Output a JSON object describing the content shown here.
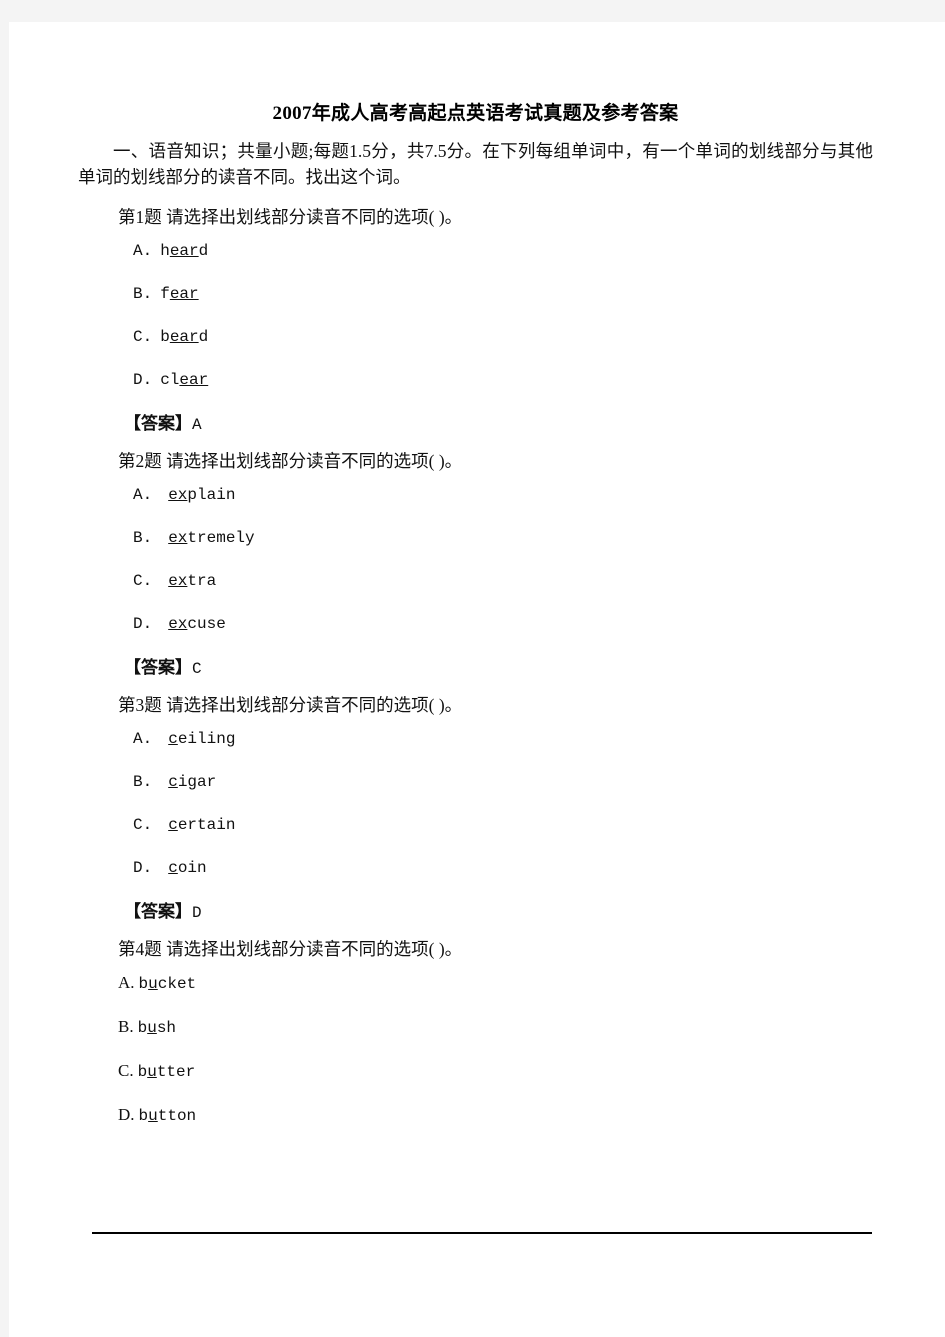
{
  "document": {
    "title": "2007年成人高考高起点英语考试真题及参考答案",
    "section_intro": "一、语音知识；共量小题;每题1.5分，共7.5分。在下列每组单词中，有一个单词的划线部分与其他单词的划线部分的读音不同。找出这个词。",
    "answer_label": "【答案】"
  },
  "questions": [
    {
      "stem": "第1题 请选择出划线部分读音不同的选项( )。",
      "option_style": "spaced",
      "options": [
        {
          "label": "A.",
          "gap": "  ",
          "pre": "h",
          "underlined": "ear",
          "post": "d"
        },
        {
          "label": "B.",
          "gap": "  ",
          "pre": "f",
          "underlined": "ear",
          "post": ""
        },
        {
          "label": "C.",
          "gap": "  ",
          "pre": "b",
          "underlined": "ear",
          "post": "d"
        },
        {
          "label": "D.",
          "gap": "  ",
          "pre": "cl",
          "underlined": "ear",
          "post": ""
        }
      ],
      "answer": "A"
    },
    {
      "stem": "第2题 请选择出划线部分读音不同的选项( )。",
      "option_style": "wide",
      "options": [
        {
          "label": "A.",
          "gap": "    ",
          "pre": "",
          "underlined": "ex",
          "post": "plain"
        },
        {
          "label": "B.",
          "gap": "    ",
          "pre": "",
          "underlined": "ex",
          "post": "tremely"
        },
        {
          "label": "C.",
          "gap": "    ",
          "pre": "",
          "underlined": "ex",
          "post": "tra"
        },
        {
          "label": "D.",
          "gap": "    ",
          "pre": "",
          "underlined": "ex",
          "post": "cuse"
        }
      ],
      "answer": "C"
    },
    {
      "stem": "第3题 请选择出划线部分读音不同的选项( )。",
      "option_style": "wide",
      "options": [
        {
          "label": "A.",
          "gap": "    ",
          "pre": "",
          "underlined": "c",
          "post": "eiling"
        },
        {
          "label": "B.",
          "gap": "    ",
          "pre": "",
          "underlined": "c",
          "post": "igar"
        },
        {
          "label": "C.",
          "gap": "    ",
          "pre": "",
          "underlined": "c",
          "post": "ertain"
        },
        {
          "label": "D.",
          "gap": "    ",
          "pre": "",
          "underlined": "c",
          "post": "oin"
        }
      ],
      "answer": "D"
    },
    {
      "stem": "第4题 请选择出划线部分读音不同的选项( )。",
      "option_style": "tight",
      "options": [
        {
          "label": "A.",
          "gap": " ",
          "pre": "b",
          "underlined": "u",
          "post": "cket"
        },
        {
          "label": "B.",
          "gap": " ",
          "pre": "b",
          "underlined": "u",
          "post": "sh"
        },
        {
          "label": "C.",
          "gap": " ",
          "pre": "b",
          "underlined": "u",
          "post": "tter"
        },
        {
          "label": "D.",
          "gap": " ",
          "pre": "b",
          "underlined": "u",
          "post": "tton"
        }
      ],
      "answer": null
    }
  ],
  "colors": {
    "page_background": "#ffffff",
    "gutter_background": "#f4f4f4",
    "text": "#111111",
    "rule": "#000000"
  }
}
